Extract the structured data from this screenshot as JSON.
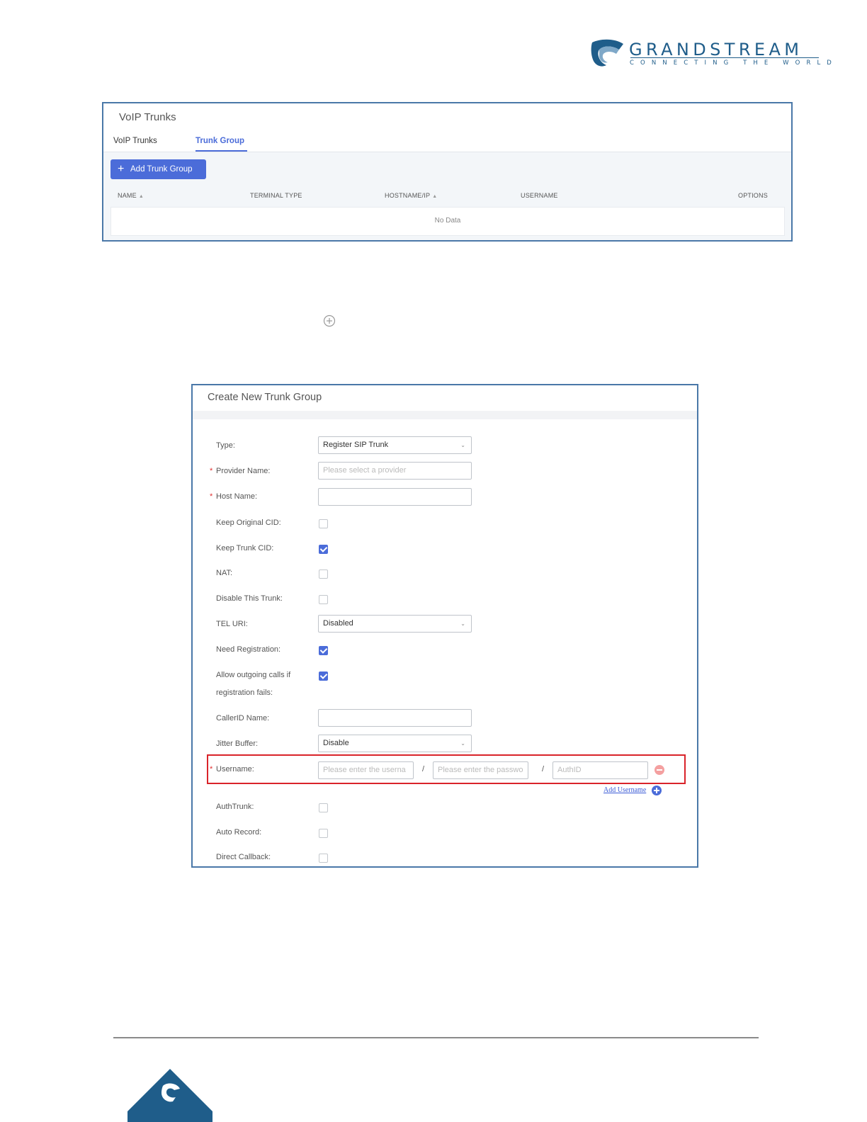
{
  "brand": {
    "name": "GRANDSTREAM",
    "tagline": "CONNECTING THE WORLD",
    "color": "#1f5d8a"
  },
  "trunks_panel": {
    "title": "VoIP Trunks",
    "tabs": [
      {
        "label": "VoIP Trunks",
        "active": false
      },
      {
        "label": "Trunk Group",
        "active": true
      }
    ],
    "add_button_label": "Add Trunk Group",
    "columns": [
      "NAME",
      "TERMINAL TYPE",
      "HOSTNAME/IP",
      "USERNAME",
      "OPTIONS"
    ],
    "rows": [],
    "empty_text": "No Data",
    "accent": "#4b6cd9"
  },
  "create_panel": {
    "title": "Create New Trunk Group",
    "fields": {
      "type": {
        "label": "Type:",
        "value": "Register SIP Trunk"
      },
      "provider_name": {
        "label": "Provider Name:",
        "required": true,
        "placeholder": "Please select a provider"
      },
      "host_name": {
        "label": "Host Name:",
        "required": true,
        "value": ""
      },
      "keep_original_cid": {
        "label": "Keep Original CID:",
        "checked": false
      },
      "keep_trunk_cid": {
        "label": "Keep Trunk CID:",
        "checked": true
      },
      "nat": {
        "label": "NAT:",
        "checked": false
      },
      "disable_this_trunk": {
        "label": "Disable This Trunk:",
        "checked": false
      },
      "tel_uri": {
        "label": "TEL URI:",
        "value": "Disabled"
      },
      "need_registration": {
        "label": "Need Registration:",
        "checked": true
      },
      "allow_outgoing": {
        "label_line1": "Allow outgoing calls if",
        "label_line2": "registration fails:",
        "checked": true
      },
      "callerid_name": {
        "label": "CallerID Name:",
        "value": ""
      },
      "jitter_buffer": {
        "label": "Jitter Buffer:",
        "value": "Disable"
      },
      "username": {
        "label": "Username:",
        "required": true,
        "username_placeholder": "Please enter the userna",
        "password_placeholder": "Please enter the passwo",
        "authid_placeholder": "AuthID",
        "separator": "/"
      },
      "add_username_label": "Add Username",
      "auth_trunk": {
        "label": "AuthTrunk:",
        "checked": false
      },
      "auto_record": {
        "label": "Auto Record:",
        "checked": false
      },
      "direct_callback": {
        "label": "Direct Callback:",
        "checked": false
      }
    },
    "highlight_color": "#d9232a"
  }
}
